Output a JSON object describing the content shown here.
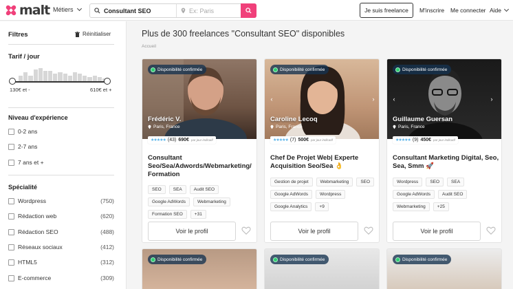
{
  "header": {
    "logo_text": "malt",
    "metiers_label": "Métiers",
    "search_value": "Consultant SEO",
    "location_placeholder": "Ex: Paris",
    "freelance_button": "Je suis freelance",
    "signup_link": "M'inscrire",
    "login_link": "Me connecter",
    "help_link": "Aide"
  },
  "sidebar": {
    "filters_title": "Filtres",
    "reset_label": "Réinitialiser",
    "rate_title": "Tarif / jour",
    "rate_min": "130€ et -",
    "rate_max": "610€ et +",
    "rate_histogram": [
      4,
      6,
      4,
      8,
      9,
      7,
      7,
      5,
      6,
      5,
      4,
      6,
      5,
      4,
      3,
      4,
      3,
      2
    ],
    "experience_title": "Niveau d'expérience",
    "experience": [
      {
        "label": "0-2 ans"
      },
      {
        "label": "2-7 ans"
      },
      {
        "label": "7 ans et +"
      }
    ],
    "speciality_title": "Spécialité",
    "specialities": [
      {
        "label": "Wordpress",
        "count": "(750)"
      },
      {
        "label": "Rédaction web",
        "count": "(620)"
      },
      {
        "label": "Rédaction SEO",
        "count": "(488)"
      },
      {
        "label": "Réseaux sociaux",
        "count": "(412)"
      },
      {
        "label": "HTML5",
        "count": "(312)"
      },
      {
        "label": "E-commerce",
        "count": "(309)"
      }
    ]
  },
  "main": {
    "title": "Plus de 300 freelances \"Consultant SEO\" disponibles",
    "breadcrumb": "Accueil",
    "availability_badge": "Disponibilité confirmée",
    "view_profile_label": "Voir le profil",
    "price_note": "par jour indicatif",
    "cards": [
      {
        "name": "Frédéric V.",
        "location": "Paris, France",
        "reviews": "(43)",
        "price": "690€",
        "title": "Consultant Seo/Sea/Adwords/Webmarketing/ Formation",
        "tags": [
          "SEO",
          "SEA",
          "Audit SEO",
          "Google AdWords",
          "Webmarketing",
          "Formation SEO",
          "+31"
        ],
        "photo_color": "#7a5a48"
      },
      {
        "name": "Caroline Lecoq",
        "location": "Paris, France",
        "reviews": "(7)",
        "price": "500€",
        "title": "Chef De Projet Web| Experte Acquisition Seo/Sea 👌",
        "tags": [
          "Gestion de projet",
          "Webmarketing",
          "SEO",
          "Google AdWords",
          "Wordpress",
          "Google Analytics",
          "+9"
        ],
        "photo_color": "#c49a7a"
      },
      {
        "name": "Guillaume Guersan",
        "location": "Paris, France",
        "reviews": "(9)",
        "price": "450€",
        "title": "Consultant Marketing Digital, Seo, Sea, Smm 🚀",
        "tags": [
          "Wordpress",
          "SEO",
          "SEA",
          "Google AdWords",
          "Audit SEO",
          "Webmarketing",
          "+25"
        ],
        "photo_color": "#2c2c2c"
      }
    ]
  },
  "colors": {
    "brand": "#f0407a",
    "available": "#2ecc71",
    "stars": "#57b2e8"
  }
}
